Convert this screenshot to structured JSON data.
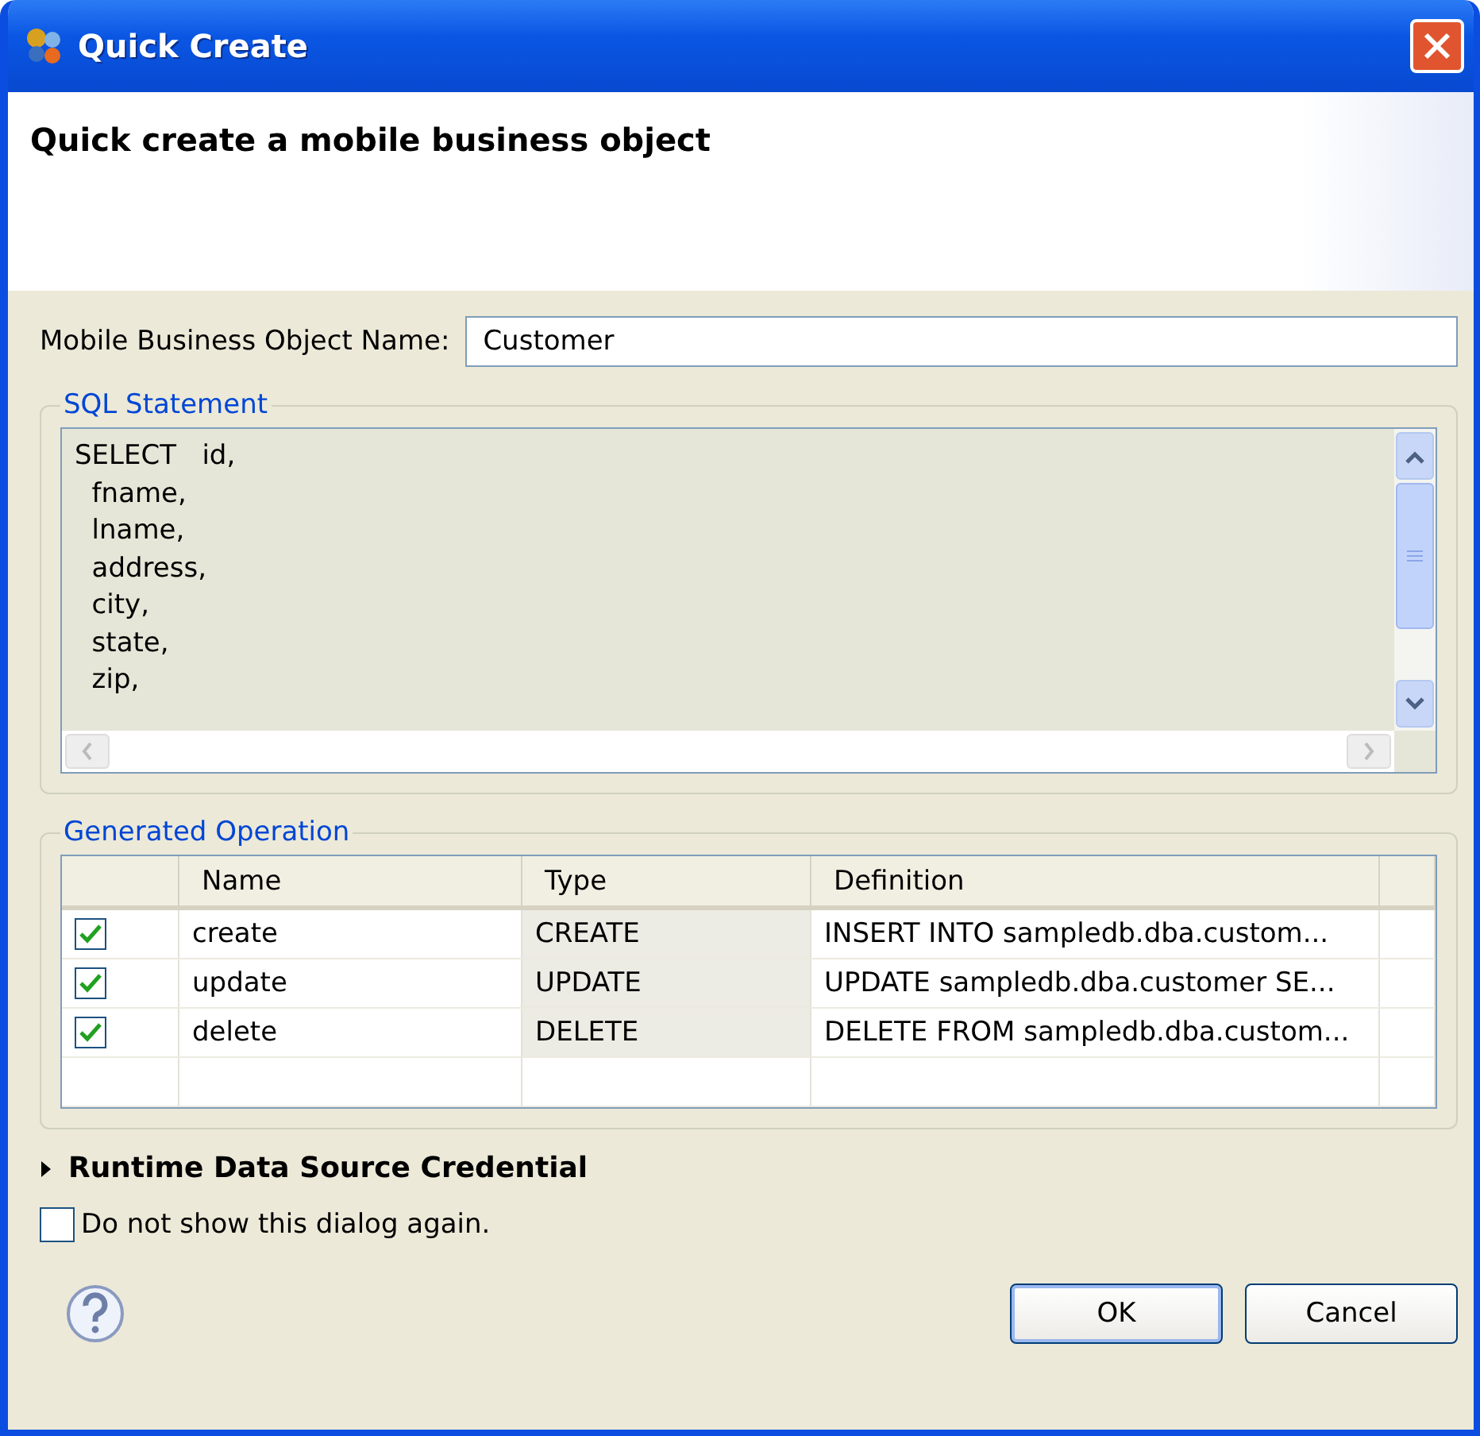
{
  "window": {
    "title": "Quick Create"
  },
  "header": {
    "title": "Quick create a mobile business object"
  },
  "name_field": {
    "label": "Mobile Business Object Name:",
    "value": "Customer"
  },
  "sql_group": {
    "title": "SQL Statement",
    "lines": [
      "SELECT   id,",
      "  fname,",
      "  lname,",
      "  address,",
      "  city,",
      "  state,",
      "  zip,"
    ]
  },
  "operations_group": {
    "title": "Generated Operation",
    "columns": [
      "Name",
      "Type",
      "Definition"
    ],
    "rows": [
      {
        "checked": true,
        "name": "create",
        "type": "CREATE",
        "definition": "INSERT INTO sampledb.dba.custom..."
      },
      {
        "checked": true,
        "name": "update",
        "type": "UPDATE",
        "definition": "UPDATE sampledb.dba.customer SE..."
      },
      {
        "checked": true,
        "name": "delete",
        "type": "DELETE",
        "definition": "DELETE FROM sampledb.dba.custom..."
      }
    ]
  },
  "credential_section": {
    "title": "Runtime Data Source Credential",
    "expanded": false
  },
  "dont_show_again": {
    "label": "Do not show this dialog again.",
    "checked": false
  },
  "buttons": [
    "OK",
    "Cancel"
  ]
}
